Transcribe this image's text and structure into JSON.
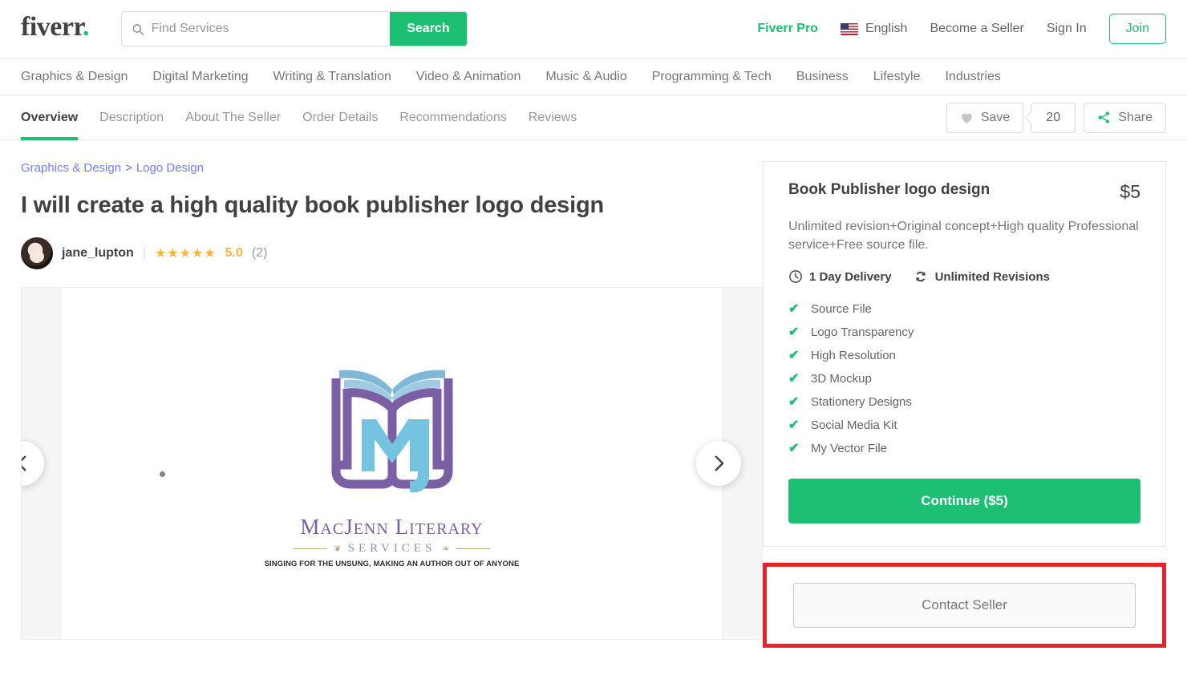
{
  "header": {
    "logo": "fiverr",
    "logo_dot": ".",
    "search": {
      "placeholder": "Find Services",
      "value": "",
      "button_label": "Search",
      "icon": "search-icon"
    },
    "nav": [
      {
        "label": "Fiverr Pro",
        "style": "pro"
      },
      {
        "label": "English",
        "style": "lang",
        "icon": "us-flag-icon"
      },
      {
        "label": "Become a Seller",
        "style": "plain"
      },
      {
        "label": "Sign In",
        "style": "plain"
      }
    ],
    "join_label": "Join"
  },
  "categories": [
    "Graphics & Design",
    "Digital Marketing",
    "Writing & Translation",
    "Video & Animation",
    "Music & Audio",
    "Programming & Tech",
    "Business",
    "Lifestyle",
    "Industries"
  ],
  "tabs": [
    {
      "label": "Overview",
      "active": true
    },
    {
      "label": "Description",
      "active": false
    },
    {
      "label": "About The Seller",
      "active": false
    },
    {
      "label": "Order Details",
      "active": false
    },
    {
      "label": "Recommendations",
      "active": false
    },
    {
      "label": "Reviews",
      "active": false
    }
  ],
  "actions": {
    "save_label": "Save",
    "save_icon": "heart-icon",
    "save_count": "20",
    "share_label": "Share",
    "share_icon": "share-icon"
  },
  "breadcrumb": {
    "first": "Graphics & Design",
    "separator": ">",
    "second": "Logo Design"
  },
  "gig": {
    "title": "I will create a high quality book publisher logo design",
    "seller": "jane_lupton",
    "stars": "★★★★★",
    "score": "5.0",
    "reviews": "(2)"
  },
  "carousel": {
    "prev_icon": "chevron-left-icon",
    "next_icon": "chevron-right-icon",
    "image": {
      "brand_mac": "M",
      "brand_line1_a": "AC",
      "brand_line1_b": "J",
      "brand_line1_c": "ENN",
      "brand_line1_d": "L",
      "brand_line1_e": "ITERARY",
      "services": "SERVICES",
      "tagline": "SINGING FOR THE UNSUNG, MAKING AN AUTHOR OUT OF ANYONE",
      "monogram": "MJ"
    }
  },
  "package": {
    "title": "Book Publisher logo design",
    "price": "$5",
    "description": "Unlimited revision+Original concept+High quality Professional service+Free source file.",
    "delivery": "1 Day Delivery",
    "delivery_icon": "clock-icon",
    "revisions": "Unlimited Revisions",
    "revisions_icon": "refresh-icon",
    "features": [
      "Source File",
      "Logo Transparency",
      "High Resolution",
      "3D Mockup",
      "Stationery Designs",
      "Social Media Kit",
      "My Vector File"
    ],
    "continue_label": "Continue ($5)",
    "contact_label": "Contact Seller"
  },
  "colors": {
    "brand_green": "#1dbf73",
    "annotation_red": "#e8212a",
    "star_gold": "#ffb33e",
    "link_blue": "#6f7eff"
  }
}
